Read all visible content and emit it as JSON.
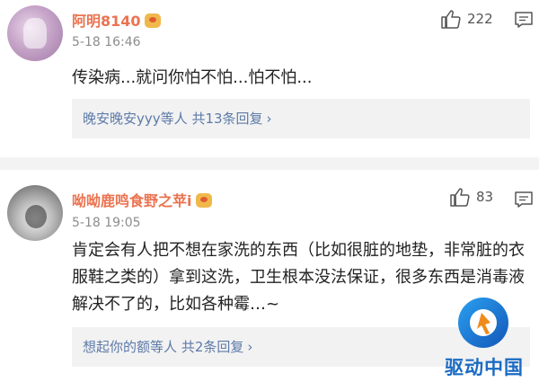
{
  "comments": [
    {
      "username": "阿明8140",
      "time": "5-18 16:46",
      "likes": "222",
      "text": "传染病...就问你怕不怕...怕不怕...",
      "reply_user": "晚安晚安yyy",
      "reply_mid": "等人",
      "reply_count": "共13条回复",
      "reply_arrow": "›"
    },
    {
      "username": "呦呦鹿鸣食野之苹i",
      "time": "5-18 19:05",
      "likes": "83",
      "text": "肯定会有人把不想在家洗的东西（比如很脏的地垫，非常脏的衣服鞋之类的）拿到这洗，卫生根本没法保证，很多东西是消毒液解决不了的，比如各种霉…~",
      "reply_user": "想起你的额",
      "reply_mid": "等人",
      "reply_count": "共2条回复",
      "reply_arrow": "›"
    }
  ],
  "watermark": {
    "text": "驱动中国",
    "color": "#1a6bc4"
  },
  "icons": {
    "like": "thumbs-up-icon",
    "comment": "comment-bubble-icon",
    "badge": "member-crown-badge-icon"
  },
  "colors": {
    "username": "#eb7350",
    "link": "#5d7aa8",
    "time": "#8d8d8d"
  }
}
